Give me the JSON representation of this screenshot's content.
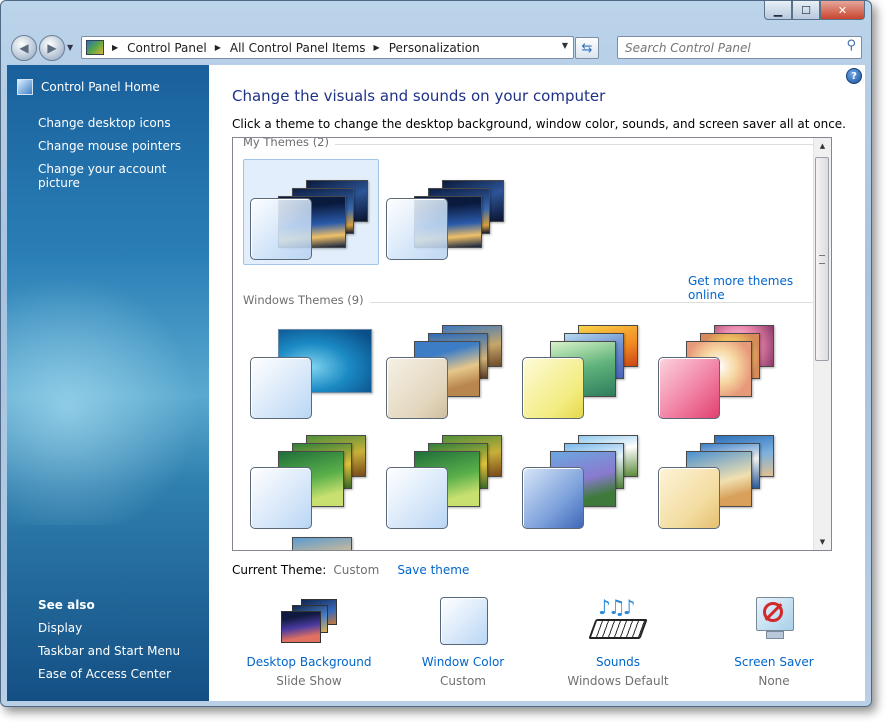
{
  "window": {
    "close_label": "✕",
    "maximize_label": "☐",
    "minimize_label": "▁"
  },
  "navigation": {
    "breadcrumb": [
      "Control Panel",
      "All Control Panel Items",
      "Personalization"
    ],
    "search_placeholder": "Search Control Panel"
  },
  "sidebar": {
    "home": "Control Panel Home",
    "links": [
      "Change desktop icons",
      "Change mouse pointers",
      "Change your account picture"
    ],
    "see_also_title": "See also",
    "see_also": [
      "Display",
      "Taskbar and Start Menu",
      "Ease of Access Center"
    ]
  },
  "main": {
    "heading": "Change the visuals and sounds on your computer",
    "subtitle": "Click a theme to change the desktop background, window color, sounds, and screen saver all at once.",
    "help_label": "?",
    "my_themes_title": "My Themes (2)",
    "get_more_link": "Get more themes online",
    "windows_themes_title": "Windows Themes (9)",
    "current_theme_label": "Current Theme:",
    "current_theme_value": "Custom",
    "save_theme_link": "Save theme"
  },
  "theme_colors": {
    "blue": "#cfe3f8",
    "sand": "#e2d6bd",
    "yellow": "#f3ec80",
    "pink": "#f07ca0",
    "amber": "#f3dca0"
  },
  "tools": [
    {
      "name": "Desktop Background",
      "value": "Slide Show",
      "icon": "desktop-background-icon"
    },
    {
      "name": "Window Color",
      "value": "Custom",
      "icon": "window-color-icon"
    },
    {
      "name": "Sounds",
      "value": "Windows Default",
      "icon": "sounds-icon"
    },
    {
      "name": "Screen Saver",
      "value": "None",
      "icon": "screen-saver-icon"
    }
  ]
}
